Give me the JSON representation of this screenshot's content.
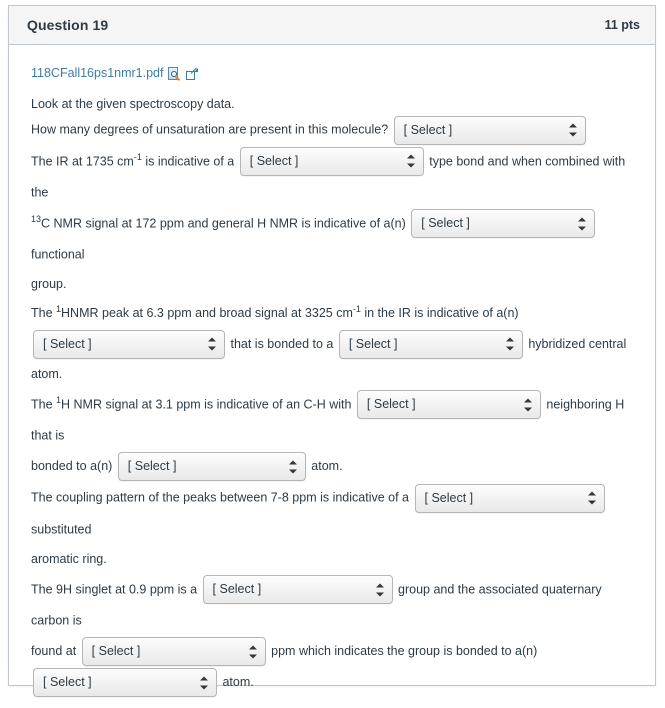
{
  "header": {
    "title": "Question 19",
    "points": "11 pts"
  },
  "attachment": {
    "filename": "118CFall16ps1nmr1.pdf",
    "preview_icon": "document-preview-icon",
    "external_link_icon": "external-link-icon"
  },
  "intro": "Look at the given spectroscopy data.",
  "select_placeholder": "[ Select ]",
  "questions": [
    {
      "id": "q1",
      "before": "How many degrees of unsaturation are present in this molecule?",
      "after": "",
      "select": "[ Select ]"
    },
    {
      "id": "q2",
      "before_a": "The IR at 1735 cm",
      "before_sup": "-1",
      "before_b": " is indicative of a",
      "after": "type bond and when combined with the",
      "select": "[ Select ]"
    },
    {
      "id": "q3",
      "sup": "13",
      "before": "C NMR signal at 172 ppm and general H NMR is indicative of a(n)",
      "after": "functional",
      "tail": "group.",
      "select": "[ Select ]"
    },
    {
      "id": "q4",
      "line_a": "The ",
      "line_sup1": "1",
      "line_b": "HNMR peak at 6.3 ppm and broad signal at 3325 cm",
      "line_sup2": "-1",
      "line_c": " in the IR is indicative of a(n)",
      "select_1": "[ Select ]",
      "mid": "that is bonded to a",
      "select_2": "[ Select ]",
      "after": "hybridized central atom."
    },
    {
      "id": "q5",
      "before_a": "The ",
      "before_sup": "1",
      "before_b": "H NMR signal at 3.1 ppm is indicative of an C-H with",
      "select_1": "[ Select ]",
      "after_1": "neighboring H that is",
      "before_2": "bonded to a(n)",
      "select_2": "[ Select ]",
      "after_2": "atom."
    },
    {
      "id": "q6",
      "before": "The coupling pattern of the peaks between 7-8 ppm is indicative of a",
      "select": "[ Select ]",
      "after": "substituted",
      "tail": "aromatic ring."
    },
    {
      "id": "q7",
      "before": "The 9H singlet at 0.9 ppm is a",
      "select_1": "[ Select ]",
      "after_1": "group and the associated quaternary carbon is",
      "before_2": "found at",
      "select_2": "[ Select ]",
      "after_2": "ppm which indicates the group is bonded to a(n)",
      "select_3": "[ Select ]",
      "after_3": "atom."
    }
  ],
  "colors": {
    "link": "#3e7ca6",
    "text": "#2d3b45",
    "header_bg": "#f5f5f5",
    "border": "#c1c7cf"
  }
}
